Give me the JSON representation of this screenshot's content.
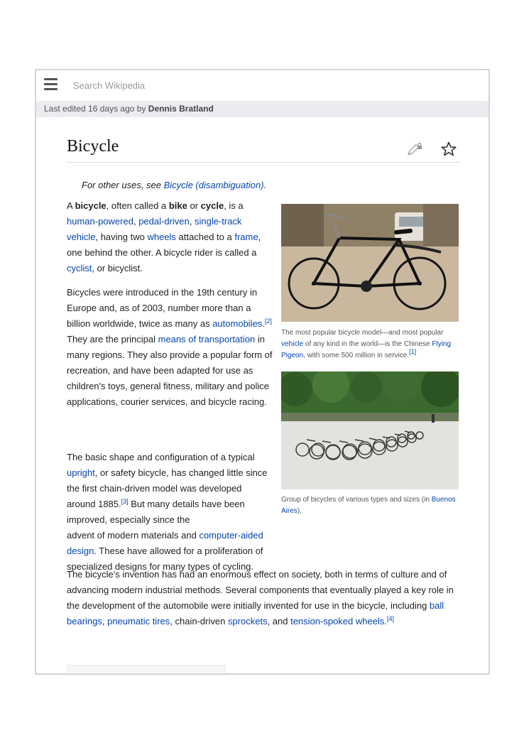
{
  "header": {
    "search_placeholder": "Search Wikipedia"
  },
  "last_edited": {
    "prefix": "Last edited 16 days ago by ",
    "user": "Dennis Bratland"
  },
  "page": {
    "title": "Bicycle"
  },
  "hatnote": {
    "prefix": "For other uses, see ",
    "link": "Bicycle (disambiguation)",
    "suffix": "."
  },
  "p1": {
    "t1": "A ",
    "b1": "bicycle",
    "t2": ", often called a ",
    "b2": "bike",
    "t3": " or ",
    "b3": "cycle",
    "t4": ", is a ",
    "l1": "human-powered",
    "t5": ", ",
    "l2": "pedal-driven",
    "t6": ", ",
    "l3": "single-track vehicle",
    "t7": ", having two ",
    "l4": "wheels",
    "t8": " attached to a ",
    "l5": "frame",
    "t9": ", one behind the other. A bicycle rider is called a ",
    "l6": "cyclist",
    "t10": ", or bicyclist."
  },
  "p2": {
    "t1": "Bicycles were introduced in the 19th century in Europe and, as of 2003, number more than a billion worldwide, twice as many as ",
    "l1": "automobiles.",
    "ref1": "[2]",
    "t2": " They are the principal ",
    "l2": "means of transportation",
    "t3": " in many regions. They also provide a popular form of recreation, and have been adapted for use as children's toys, general fitness, military and police applications, courier services, and bicycle racing."
  },
  "p3": {
    "t1": "The basic shape and configuration of a typical ",
    "l1": "upright",
    "t2": ", or safety bicycle, has changed little since the first chain-driven model was developed around 1885.",
    "ref1": "[3]",
    "t3": " But many details have been improved, especially since the"
  },
  "p3_cont": {
    "t1": "advent of modern materials and ",
    "l1": "computer-aided design",
    "t2": ". These have allowed for a proliferation of specialized designs for many types of cycling."
  },
  "p4": {
    "t1": "The bicycle's invention has had an enormous effect on society, both in terms of culture and of advancing modern industrial methods. Several components that eventually played a key role in the development of the automobile were initially invented for use in the bicycle, including ",
    "l1": "ball bearings",
    "t2": ", ",
    "l2": "pneumatic tires",
    "t3": ", chain-driven ",
    "l3": "sprockets",
    "t4": ", and ",
    "l4": "tension-spoked wheels.",
    "ref1": "[4]"
  },
  "figure1": {
    "caption_t1": "The most popular bicycle model—and most popular ",
    "caption_l1": "vehicle",
    "caption_t2": " of any kind in the world—is the Chinese ",
    "caption_l2": "Flying Pigeon",
    "caption_t3": ", with some 500 million in service.",
    "caption_ref": "[1]"
  },
  "figure2": {
    "caption_t1": "Group of bicycles of various types and sizes (in ",
    "caption_l1": "Buenos Aires",
    "caption_t2": ")."
  },
  "icons": {
    "menu": "hamburger-menu-icon",
    "edit": "pencil-lock-icon",
    "watch": "star-icon"
  },
  "colors": {
    "link": "#0645ad",
    "meta_bar": "#eaecf0"
  }
}
